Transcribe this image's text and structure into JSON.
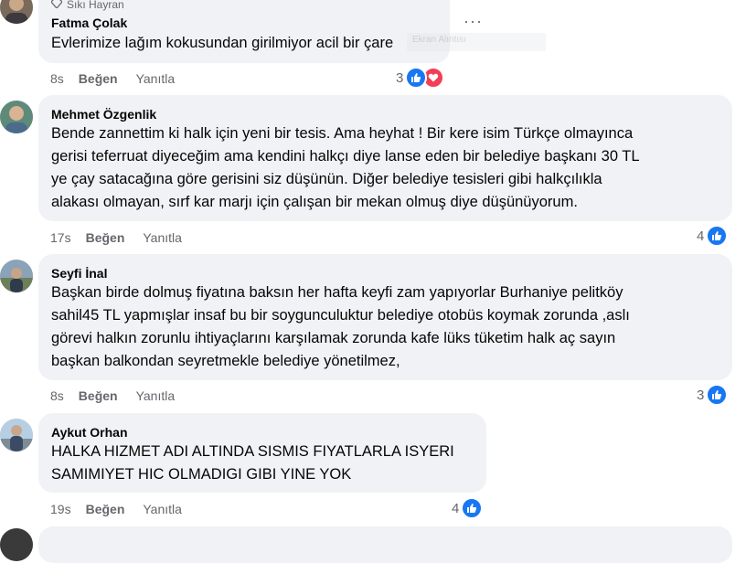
{
  "comments": [
    {
      "badge": "Sıkı Hayran",
      "author": "Fatma Çolak",
      "text": "Evlerimize lağım kokusundan girilmiyor acil bir çare",
      "time": "8s",
      "like_label": "Beğen",
      "reply_label": "Yanıtla",
      "reaction_count": "3",
      "reactions": [
        "like-icon",
        "love-icon"
      ]
    },
    {
      "author": "Mehmet Özgenlik",
      "text": "Bende zannettim ki halk için yeni bir tesis. Ama heyhat ! Bir kere isim Türkçe olmayınca\ngerisi teferruat diyeceğim ama kendini halkçı diye lanse eden bir belediye başkanı 30 TL\nye çay satacağına göre gerisini siz düşünün. Diğer belediye tesisleri gibi halkçılıkla\nalakası olmayan, sırf kar marjı için çalışan bir mekan olmuş diye düşünüyorum.",
      "time": "17s",
      "like_label": "Beğen",
      "reply_label": "Yanıtla",
      "reaction_count": "4",
      "reactions": [
        "like-icon"
      ]
    },
    {
      "author": "Seyfi İnal",
      "text": "Başkan birde dolmuş fiyatına baksın her hafta keyfi zam yapıyorlar Burhaniye pelitköy\nsahil45 TL yapmışlar insaf bu bir soygunculuktur belediye otobüs koymak zorunda ,aslı\ngörevi halkın zorunlu ihtiyaçlarını karşılamak zorunda kafe lüks tüketim halk aç sayın\nbaşkan balkondan seyretmekle belediye yönetilmez,",
      "time": "8s",
      "like_label": "Beğen",
      "reply_label": "Yanıtla",
      "reaction_count": "3",
      "reactions": [
        "like-icon"
      ]
    },
    {
      "author": "Aykut Orhan",
      "text": "HALKA HIZMET ADI ALTINDA SISMIS FIYATLARLA ISYERI\nSAMIMIYET HIC OLMADIGI GIBI YINE YOK",
      "time": "19s",
      "like_label": "Beğen",
      "reply_label": "Yanıtla",
      "reaction_count": "4",
      "reactions": [
        "like-icon"
      ]
    }
  ],
  "more_options_label": "···",
  "colors": {
    "bubble": "#f0f2f5",
    "like_blue": "#1877f2",
    "love_red": "#f33e58",
    "meta_gray": "#65676b"
  }
}
